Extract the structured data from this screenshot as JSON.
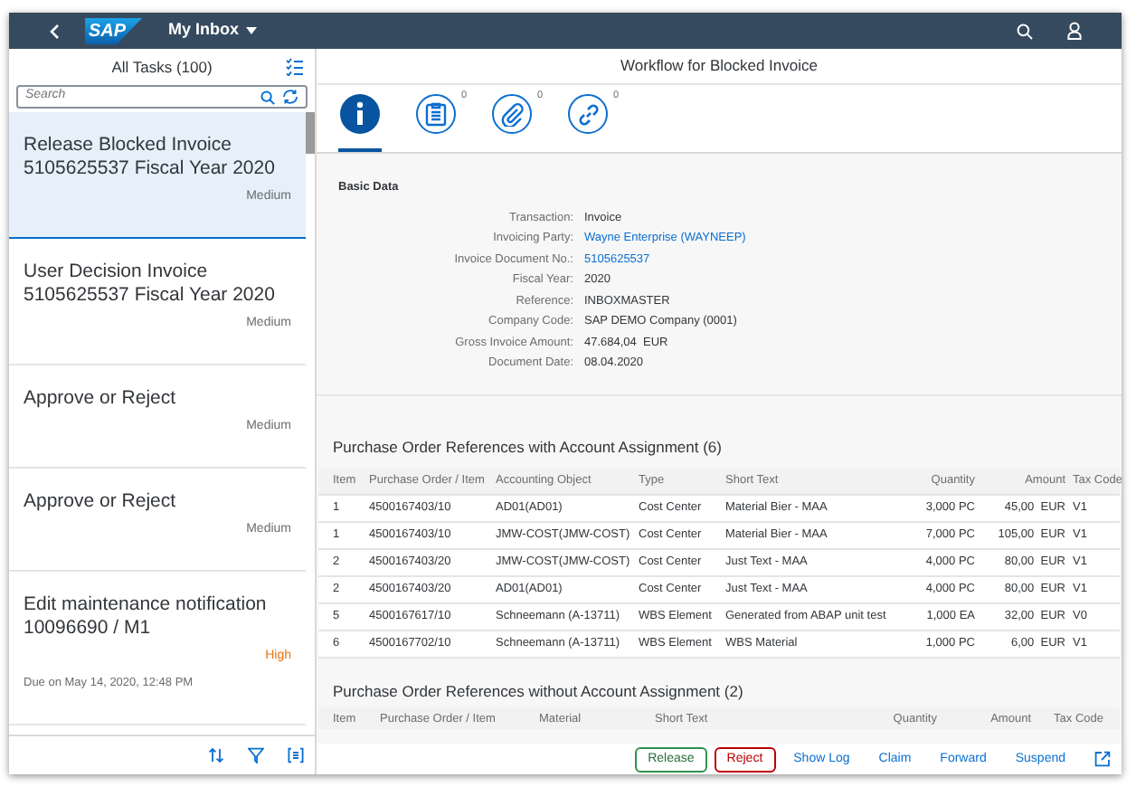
{
  "header": {
    "logo": "SAP",
    "title": "My Inbox"
  },
  "task_list": {
    "title": "All Tasks (100)",
    "search": {
      "placeholder": "Search"
    },
    "items": [
      {
        "title": "Release Blocked Invoice 5105625537 Fiscal Year 2020",
        "priority": "Medium",
        "color": "#6a6d70",
        "selected": true
      },
      {
        "title": "User Decision Invoice 5105625537 Fiscal Year 2020",
        "priority": "Medium",
        "color": "#6a6d70",
        "selected": false
      },
      {
        "title": "Approve or Reject",
        "priority": "Medium",
        "color": "#6a6d70",
        "selected": false
      },
      {
        "title": "Approve or Reject",
        "priority": "Medium",
        "color": "#6a6d70",
        "selected": false
      },
      {
        "title": "Edit maintenance notification 10096690 / M1",
        "priority": "High",
        "color": "#e9730c",
        "due": "Due on May 14, 2020, 12:48 PM",
        "selected": false
      }
    ]
  },
  "detail": {
    "title": "Workflow for Blocked Invoice",
    "tabs": [
      {
        "kind": "info",
        "selected": true
      },
      {
        "kind": "notes",
        "count": "0",
        "selected": false
      },
      {
        "kind": "attachments",
        "count": "0",
        "selected": false
      },
      {
        "kind": "links",
        "count": "0",
        "selected": false
      }
    ],
    "basic_data": {
      "title": "Basic Data",
      "fields": [
        {
          "label": "Transaction:",
          "value": "Invoice",
          "link": false
        },
        {
          "label": "Invoicing Party:",
          "value": "Wayne Enterprise (WAYNEEP)",
          "link": true
        },
        {
          "label": "Invoice Document No.:",
          "value": "5105625537",
          "link": true
        },
        {
          "label": "Fiscal Year:",
          "value": "2020",
          "link": false
        },
        {
          "label": "Reference:",
          "value": "INBOXMASTER",
          "link": false
        },
        {
          "label": "Company Code:",
          "value": "SAP DEMO Company (0001)",
          "link": false
        },
        {
          "label": "Gross Invoice Amount:",
          "value": "47.684,04  EUR",
          "link": false
        },
        {
          "label": "Document Date:",
          "value": "08.04.2020",
          "link": false
        }
      ]
    },
    "table_with_assignment": {
      "title": "Purchase Order References with Account Assignment (6)",
      "columns": [
        "Item",
        "Purchase Order / Item",
        "Accounting Object",
        "Type",
        "Short Text",
        "Quantity",
        "Amount",
        "Tax Code"
      ],
      "rows": [
        [
          "1",
          "4500167403/10",
          "AD01(AD01)",
          "Cost Center",
          "Material Bier - MAA",
          "3,000 PC",
          "45,00  EUR",
          "V1"
        ],
        [
          "1",
          "4500167403/10",
          "JMW-COST(JMW-COST)",
          "Cost Center",
          "Material Bier - MAA",
          "7,000 PC",
          "105,00  EUR",
          "V1"
        ],
        [
          "2",
          "4500167403/20",
          "JMW-COST(JMW-COST)",
          "Cost Center",
          "Just Text - MAA",
          "4,000 PC",
          "80,00  EUR",
          "V1"
        ],
        [
          "2",
          "4500167403/20",
          "AD01(AD01)",
          "Cost Center",
          "Just Text - MAA",
          "4,000 PC",
          "80,00  EUR",
          "V1"
        ],
        [
          "5",
          "4500167617/10",
          "Schneemann (A-13711)",
          "WBS Element",
          "Generated from ABAP unit test",
          "1,000 EA",
          "32,00  EUR",
          "V0"
        ],
        [
          "6",
          "4500167702/10",
          "Schneemann (A-13711)",
          "WBS Element",
          "WBS Material",
          "1,000 PC",
          "6,00  EUR",
          "V1"
        ]
      ]
    },
    "table_without_assignment": {
      "title": "Purchase Order References without Account Assignment (2)",
      "columns": [
        "Item",
        "Purchase Order / Item",
        "Material",
        "Short Text",
        "Quantity",
        "Amount",
        "Tax Code"
      ]
    },
    "footer_buttons": [
      {
        "label": "Release",
        "kind": "accept"
      },
      {
        "label": "Reject",
        "kind": "reject"
      },
      {
        "label": "Show Log",
        "kind": "plain"
      },
      {
        "label": "Claim",
        "kind": "plain"
      },
      {
        "label": "Forward",
        "kind": "plain"
      },
      {
        "label": "Suspend",
        "kind": "plain"
      }
    ]
  }
}
